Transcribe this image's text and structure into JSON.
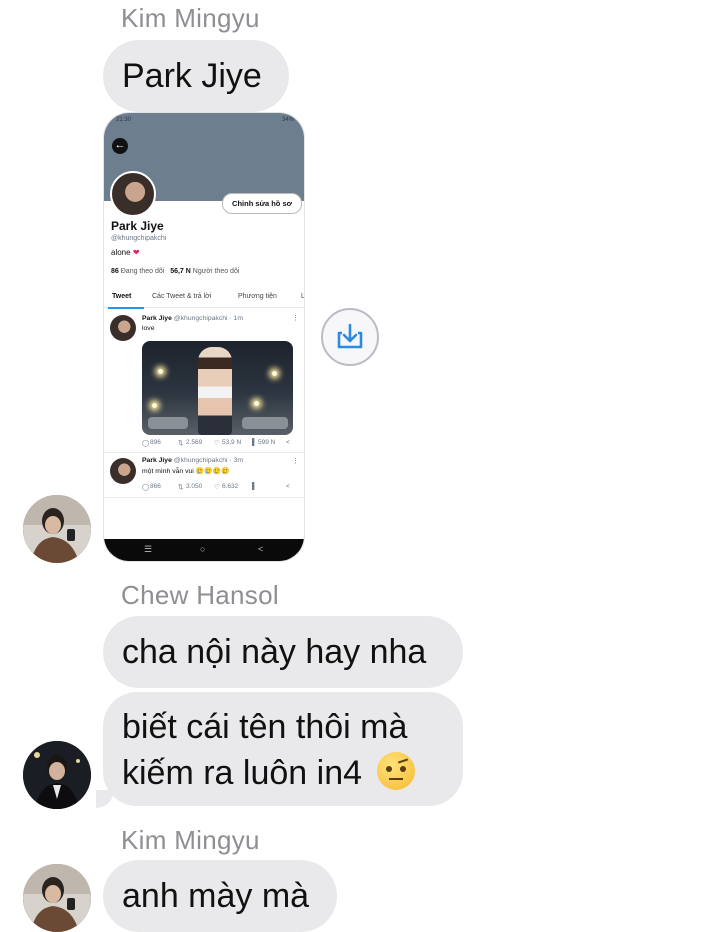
{
  "messages": [
    {
      "sender": "Kim Mingyu",
      "text": "Park Jiye"
    },
    {
      "sender": "Chew Hansol",
      "text": "cha nội này hay nha"
    },
    {
      "text_line1": "biết cái tên thôi mà",
      "text_line2": "kiếm ra luôn in4",
      "emoji": "🤨"
    },
    {
      "sender": "Kim Mingyu",
      "text": "anh mày mà"
    }
  ],
  "screenshot": {
    "status_time": "21:30",
    "status_right": "34%",
    "profile_name": "Park Jiye",
    "profile_handle": "@khungchipakchi",
    "bio": "alone",
    "edit_button": "Chỉnh sửa hồ sơ",
    "following_count": "86",
    "following_label": "Đang theo dõi",
    "followers_count": "56,7 N",
    "followers_label": "Người theo dõi",
    "tabs": [
      "Tweet",
      "Các Tweet & trả lời",
      "Phương tiện",
      "L"
    ],
    "tweets": [
      {
        "name": "Park Jiye",
        "handle": "@khungchipakchi",
        "time": "· 1m",
        "text": "love",
        "replies": "896",
        "retweets": "2.569",
        "likes": "53,9 N",
        "views": "599 N"
      },
      {
        "name": "Park Jiye",
        "handle": "@khungchipakchi",
        "time": "· 3m",
        "text": "một mình vẫn vui 🥲🥲🥲🥲",
        "replies": "866",
        "retweets": "3.050",
        "likes": "6.632",
        "views": ""
      }
    ]
  },
  "colors": {
    "bubble": "#e9e9eb",
    "sender": "#8e8e93",
    "twitter_blue": "#1d9bf0"
  },
  "icons": {
    "save": "download-tray-icon"
  }
}
